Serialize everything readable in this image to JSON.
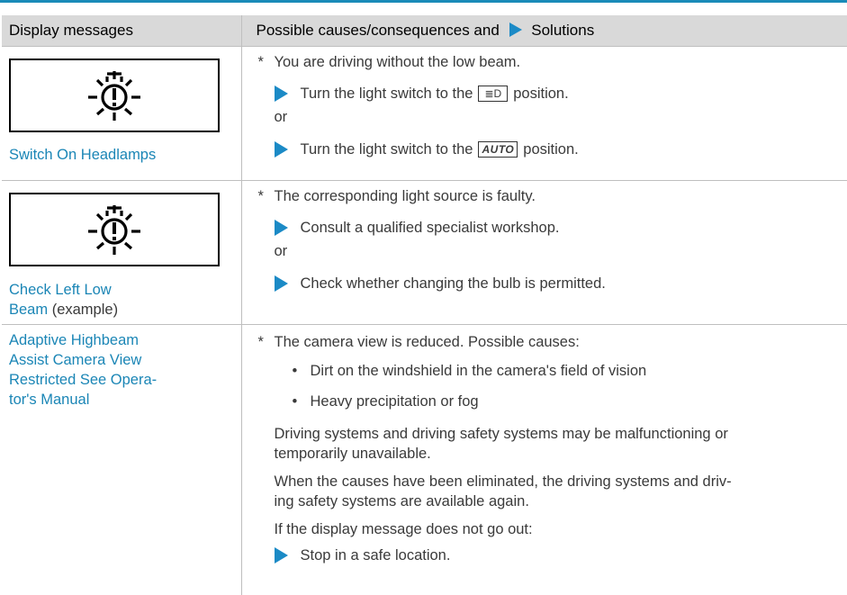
{
  "header": {
    "col1": "Display messages",
    "col2_prefix": "Possible causes/consequences and",
    "col2_suffix": "Solutions"
  },
  "rows": [
    {
      "message": "Switch On Headlamps",
      "cause": "You are driving without the low beam.",
      "step1_before": "Turn the light switch to the",
      "step1_symbol": "≣D",
      "step1_after": "position.",
      "or": "or",
      "step2_before": "Turn the light switch to the",
      "step2_symbol": "AUTO",
      "step2_after": "position."
    },
    {
      "message_link_1": "Check Left Low",
      "message_link_2": "Beam",
      "message_suffix": "(example)",
      "cause": "The corresponding light source is faulty.",
      "step1": "Consult a qualified specialist workshop.",
      "or": "or",
      "step2": "Check whether changing the bulb is permitted."
    },
    {
      "message_lines": [
        "Adaptive Highbeam",
        "Assist Camera View",
        "Restricted See Opera-",
        "tor's Manual"
      ],
      "cause": "The camera view is reduced. Possible causes:",
      "bullets": [
        "Dirt on the windshield in the camera's field of vision",
        "Heavy precipitation or fog"
      ],
      "para1_lines": [
        "Driving systems and driving safety systems may be malfunctioning or",
        "temporarily unavailable."
      ],
      "para2_lines": [
        "When the causes have been eliminated, the driving systems and driv-",
        "ing safety systems are available again."
      ],
      "para3": "If the display message does not go out:",
      "step1": "Stop in a safe location."
    }
  ],
  "symbols": {
    "star": "*",
    "bullet": "•"
  },
  "colors": {
    "accent": "#1b86b6",
    "header_bg": "#d9d9d9",
    "triangle": "#1b8ac6"
  },
  "icons": [
    "headlamp-warning-icon",
    "solution-triangle-icon"
  ]
}
